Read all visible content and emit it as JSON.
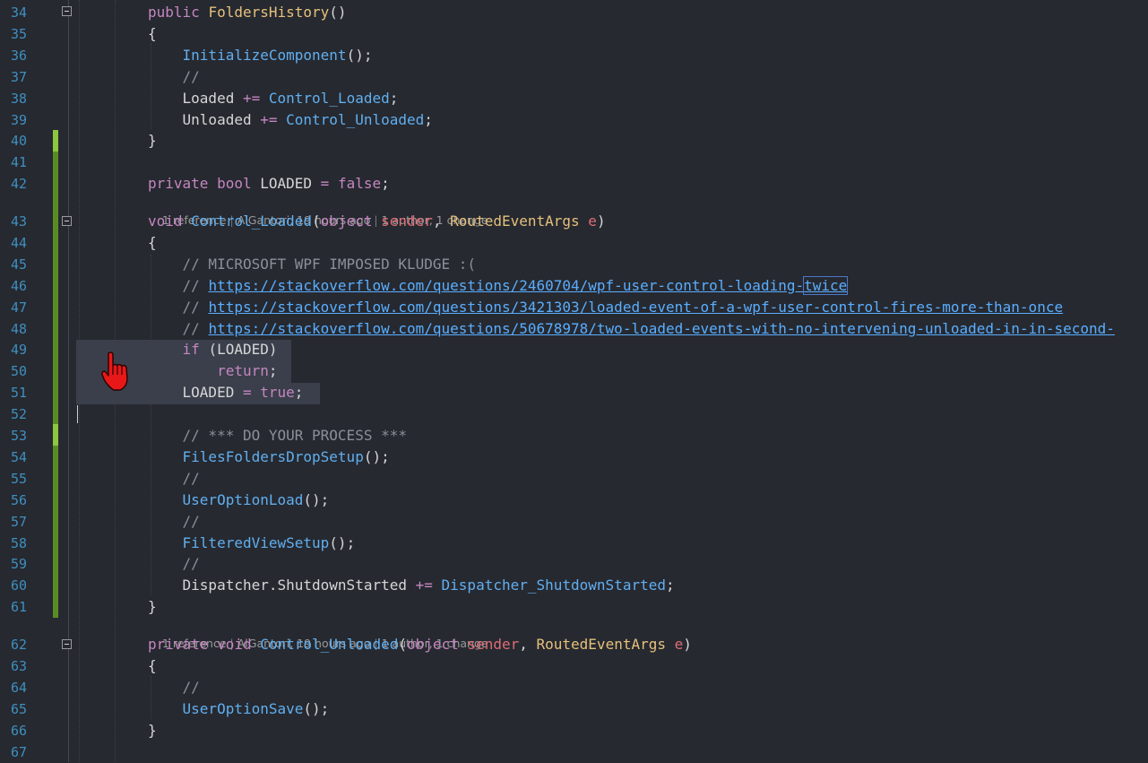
{
  "editor": {
    "lines": [
      {
        "n": "34",
        "code": [
          {
            "t": "public ",
            "c": "kw"
          },
          {
            "t": "FoldersHistory",
            "c": "tp"
          },
          {
            "t": "()",
            "c": ""
          }
        ]
      },
      {
        "n": "35",
        "code": [
          {
            "t": "{",
            "c": ""
          }
        ]
      },
      {
        "n": "36",
        "code": [
          {
            "t": "    ",
            "c": ""
          },
          {
            "t": "InitializeComponent",
            "c": "fn"
          },
          {
            "t": "();",
            "c": ""
          }
        ]
      },
      {
        "n": "37",
        "code": [
          {
            "t": "    ",
            "c": ""
          },
          {
            "t": "//",
            "c": "cm"
          }
        ]
      },
      {
        "n": "38",
        "code": [
          {
            "t": "    Loaded ",
            "c": ""
          },
          {
            "t": "+=",
            "c": "kw"
          },
          {
            "t": " ",
            "c": ""
          },
          {
            "t": "Control_Loaded",
            "c": "fn"
          },
          {
            "t": ";",
            "c": ""
          }
        ]
      },
      {
        "n": "39",
        "code": [
          {
            "t": "    Unloaded ",
            "c": ""
          },
          {
            "t": "+=",
            "c": "kw"
          },
          {
            "t": " ",
            "c": ""
          },
          {
            "t": "Control_Unloaded",
            "c": "fn"
          },
          {
            "t": ";",
            "c": ""
          }
        ]
      },
      {
        "n": "40",
        "code": [
          {
            "t": "}",
            "c": ""
          }
        ]
      },
      {
        "n": "41",
        "code": []
      },
      {
        "n": "42",
        "code": [
          {
            "t": "private ",
            "c": "kw"
          },
          {
            "t": "bool ",
            "c": "kw"
          },
          {
            "t": "LOADED ",
            "c": ""
          },
          {
            "t": "= ",
            "c": "kw"
          },
          {
            "t": "false",
            "c": "kw"
          },
          {
            "t": ";",
            "c": ""
          }
        ]
      },
      {
        "n": "43",
        "code": [
          {
            "t": "void ",
            "c": "kw"
          },
          {
            "t": "Control_Loaded",
            "c": "fn"
          },
          {
            "t": "(",
            "c": ""
          },
          {
            "t": "object ",
            "c": "kw"
          },
          {
            "t": "sender",
            "c": "pr"
          },
          {
            "t": ", ",
            "c": ""
          },
          {
            "t": "RoutedEventArgs ",
            "c": "tp"
          },
          {
            "t": "e",
            "c": "pr"
          },
          {
            "t": ")",
            "c": ""
          }
        ]
      },
      {
        "n": "44",
        "code": [
          {
            "t": "{",
            "c": ""
          }
        ]
      },
      {
        "n": "45",
        "code": [
          {
            "t": "    ",
            "c": ""
          },
          {
            "t": "// MICROSOFT WPF IMPOSED KLUDGE :(",
            "c": "cm"
          }
        ]
      },
      {
        "n": "46",
        "code": [
          {
            "t": "    ",
            "c": ""
          },
          {
            "t": "// ",
            "c": "cm"
          },
          {
            "t": "https://stackoverflow.com/questions/2460704/wpf-user-control-loading-",
            "c": "url"
          },
          {
            "t": "twice",
            "c": "url twice-box"
          }
        ]
      },
      {
        "n": "47",
        "code": [
          {
            "t": "    ",
            "c": ""
          },
          {
            "t": "// ",
            "c": "cm"
          },
          {
            "t": "https://stackoverflow.com/questions/3421303/loaded-event-of-a-wpf-user-control-fires-more-than-once",
            "c": "url"
          }
        ]
      },
      {
        "n": "48",
        "code": [
          {
            "t": "    ",
            "c": ""
          },
          {
            "t": "// ",
            "c": "cm"
          },
          {
            "t": "https://stackoverflow.com/questions/50678978/two-loaded-events-with-no-intervening-unloaded-in-in-second-",
            "c": "url"
          }
        ]
      },
      {
        "n": "49",
        "code": [
          {
            "t": "    ",
            "c": ""
          },
          {
            "t": "if ",
            "c": "kw"
          },
          {
            "t": "(LOADED)",
            "c": ""
          }
        ]
      },
      {
        "n": "50",
        "code": [
          {
            "t": "        ",
            "c": ""
          },
          {
            "t": "return",
            "c": "kw"
          },
          {
            "t": ";",
            "c": ""
          }
        ]
      },
      {
        "n": "51",
        "code": [
          {
            "t": "    LOADED ",
            "c": ""
          },
          {
            "t": "= ",
            "c": "kw"
          },
          {
            "t": "true",
            "c": "kw"
          },
          {
            "t": ";",
            "c": ""
          }
        ]
      },
      {
        "n": "52",
        "code": []
      },
      {
        "n": "53",
        "code": [
          {
            "t": "    ",
            "c": ""
          },
          {
            "t": "// *** DO YOUR PROCESS ***",
            "c": "cm"
          }
        ]
      },
      {
        "n": "54",
        "code": [
          {
            "t": "    ",
            "c": ""
          },
          {
            "t": "FilesFoldersDropSetup",
            "c": "fn"
          },
          {
            "t": "();",
            "c": ""
          }
        ]
      },
      {
        "n": "55",
        "code": [
          {
            "t": "    ",
            "c": ""
          },
          {
            "t": "//",
            "c": "cm"
          }
        ]
      },
      {
        "n": "56",
        "code": [
          {
            "t": "    ",
            "c": ""
          },
          {
            "t": "UserOptionLoad",
            "c": "fn"
          },
          {
            "t": "();",
            "c": ""
          }
        ]
      },
      {
        "n": "57",
        "code": [
          {
            "t": "    ",
            "c": ""
          },
          {
            "t": "//",
            "c": "cm"
          }
        ]
      },
      {
        "n": "58",
        "code": [
          {
            "t": "    ",
            "c": ""
          },
          {
            "t": "FilteredViewSetup",
            "c": "fn"
          },
          {
            "t": "();",
            "c": ""
          }
        ]
      },
      {
        "n": "59",
        "code": [
          {
            "t": "    ",
            "c": ""
          },
          {
            "t": "//",
            "c": "cm"
          }
        ]
      },
      {
        "n": "60",
        "code": [
          {
            "t": "    Dispatcher.ShutdownStarted ",
            "c": ""
          },
          {
            "t": "+=",
            "c": "kw"
          },
          {
            "t": " ",
            "c": ""
          },
          {
            "t": "Dispatcher_ShutdownStarted",
            "c": "fn"
          },
          {
            "t": ";",
            "c": ""
          }
        ]
      },
      {
        "n": "61",
        "code": [
          {
            "t": "}",
            "c": ""
          }
        ]
      },
      {
        "n": "62",
        "code": [
          {
            "t": "private ",
            "c": "kw"
          },
          {
            "t": "void ",
            "c": "kw"
          },
          {
            "t": "Control_Unloaded",
            "c": "fn"
          },
          {
            "t": "(",
            "c": ""
          },
          {
            "t": "object ",
            "c": "kw"
          },
          {
            "t": "sender",
            "c": "pr"
          },
          {
            "t": ", ",
            "c": ""
          },
          {
            "t": "RoutedEventArgs ",
            "c": "tp"
          },
          {
            "t": "e",
            "c": "pr"
          },
          {
            "t": ")",
            "c": ""
          }
        ]
      },
      {
        "n": "63",
        "code": [
          {
            "t": "{",
            "c": ""
          }
        ]
      },
      {
        "n": "64",
        "code": [
          {
            "t": "    ",
            "c": ""
          },
          {
            "t": "//",
            "c": "cm"
          }
        ]
      },
      {
        "n": "65",
        "code": [
          {
            "t": "    ",
            "c": ""
          },
          {
            "t": "UserOptionSave",
            "c": "fn"
          },
          {
            "t": "();",
            "c": ""
          }
        ]
      },
      {
        "n": "66",
        "code": [
          {
            "t": "}",
            "c": ""
          }
        ]
      },
      {
        "n": "67",
        "code": []
      }
    ],
    "codelens": [
      {
        "refs": "1 reference",
        "author": "AlGantori, 19 hours ago",
        "changes": "1 author, 1 change"
      },
      {
        "refs": "1 reference",
        "author": "AlGantori, 19 hours ago",
        "changes": "1 author, 1 change"
      }
    ],
    "cursor_icon": "hand-pointer-icon",
    "colors": {
      "background": "#262930",
      "line_number": "#3f8fbf",
      "change_bar": "#5b8c23",
      "selection": "#3a3f4b"
    }
  }
}
